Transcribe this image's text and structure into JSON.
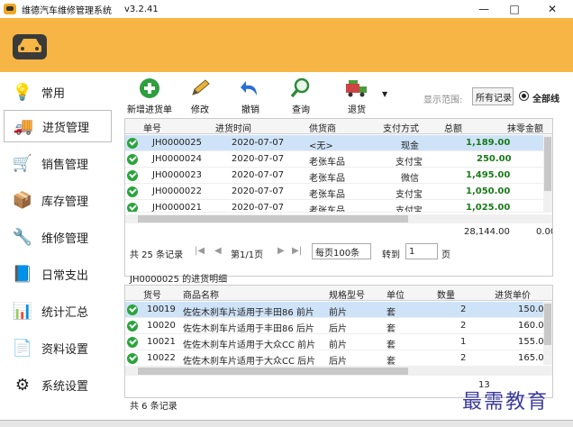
{
  "app": {
    "title": "维德汽车维修管理系统",
    "version": "v3.2.41"
  },
  "window_controls": {
    "minimize": "—",
    "maximize": "□",
    "close": "✕"
  },
  "sidebar": {
    "items": [
      {
        "label": "常用",
        "icon": "lightbulb-icon",
        "glyph": "💡"
      },
      {
        "label": "进货管理",
        "icon": "truck-icon",
        "glyph": "🚚"
      },
      {
        "label": "销售管理",
        "icon": "cart-icon",
        "glyph": "🛒"
      },
      {
        "label": "库存管理",
        "icon": "box-icon",
        "glyph": "📦"
      },
      {
        "label": "维修管理",
        "icon": "repair-icon",
        "glyph": "🔧"
      },
      {
        "label": "日常支出",
        "icon": "book-icon",
        "glyph": "📘"
      },
      {
        "label": "统计汇总",
        "icon": "chart-icon",
        "glyph": "📊"
      },
      {
        "label": "资料设置",
        "icon": "document-icon",
        "glyph": "📄"
      },
      {
        "label": "系统设置",
        "icon": "gear-icon",
        "glyph": "⚙"
      }
    ]
  },
  "toolbar": {
    "new_label": "新增进货单",
    "edit_label": "修改",
    "undo_label": "撤销",
    "query_label": "查询",
    "return_label": "退货",
    "range_label": "显示范围:",
    "range_value": "所有记录",
    "radio_label": "全部线"
  },
  "orders": {
    "headers": [
      "单号",
      "进货时间",
      "供货商",
      "支付方式",
      "总额",
      "抹零金额"
    ],
    "rows": [
      {
        "id": "JH0000025",
        "date": "2020-07-07",
        "supplier": "<无>",
        "pay": "现金",
        "total": "1,189.00"
      },
      {
        "id": "JH0000024",
        "date": "2020-07-07",
        "supplier": "老张车品",
        "pay": "支付宝",
        "total": "250.00"
      },
      {
        "id": "JH0000023",
        "date": "2020-07-07",
        "supplier": "老张车品",
        "pay": "微信",
        "total": "1,495.00"
      },
      {
        "id": "JH0000022",
        "date": "2020-07-07",
        "supplier": "老张车品",
        "pay": "支付宝",
        "total": "1,050.00"
      },
      {
        "id": "JH0000021",
        "date": "2020-07-07",
        "supplier": "老张车品",
        "pay": "支付宝",
        "total": "1,025.00"
      }
    ],
    "sum_total": "28,144.00",
    "sum_round": "0.00"
  },
  "pager": {
    "count": "共 25 条记录",
    "page": "第1/1页",
    "per_page": "每页100条",
    "goto": "转到",
    "goto_value": "1",
    "page_unit": "页"
  },
  "details": {
    "title": "JH0000025 的进货明细",
    "headers": [
      "货号",
      "商品名称",
      "规格型号",
      "单位",
      "数量",
      "进货单价"
    ],
    "rows": [
      {
        "code": "10019",
        "name": "佐佐木刹车片适用于丰田86 前片",
        "spec": "前片",
        "unit": "套",
        "qty": "2",
        "price": "150.00"
      },
      {
        "code": "10020",
        "name": "佐佐木刹车片适用于丰田86 后片",
        "spec": "后片",
        "unit": "套",
        "qty": "2",
        "price": "160.00"
      },
      {
        "code": "10021",
        "name": "佐佐木刹车片适用于大众CC 前片",
        "spec": "前片",
        "unit": "套",
        "qty": "1",
        "price": "155.00"
      },
      {
        "code": "10022",
        "name": "佐佐木刹车片适用于大众CC 后片",
        "spec": "后片",
        "unit": "套",
        "qty": "2",
        "price": "165.00"
      }
    ],
    "sum_qty": "13",
    "count": "共 6 条记录"
  },
  "watermark": "最需教育",
  "colors": {
    "banner": "#f6b544",
    "selected_row": "#cfe3f8",
    "amount": "#1a7a1a",
    "ok": "#2aa43c"
  }
}
